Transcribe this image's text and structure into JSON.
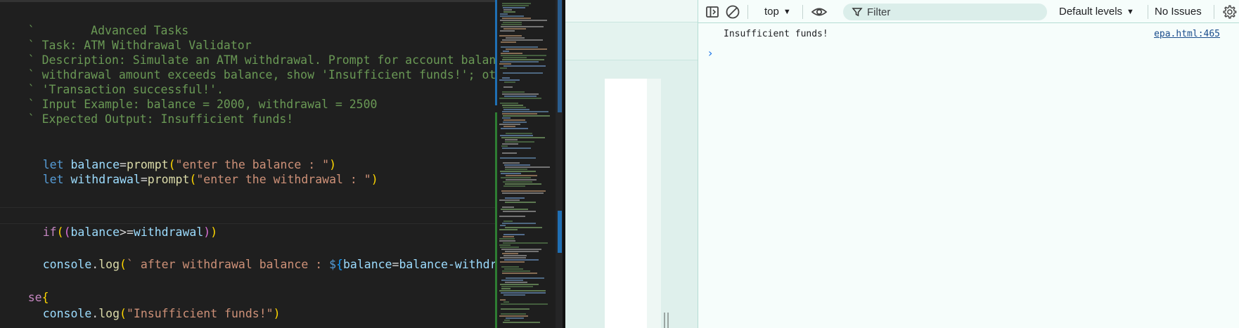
{
  "editor": {
    "lines": [
      {
        "indent": "        ",
        "text": "Advanced Tasks",
        "type": "comment"
      },
      {
        "indent": " ",
        "text": "Task: ATM Withdrawal Validator",
        "type": "comment"
      },
      {
        "indent": " ",
        "text": "Description: Simulate an ATM withdrawal. Prompt for account balance and",
        "type": "comment"
      },
      {
        "indent": " ",
        "text": "withdrawal amount exceeds balance, show 'Insufficient funds!'; otherwise",
        "type": "comment"
      },
      {
        "indent": " ",
        "text": "'Transaction successful!'.",
        "type": "comment"
      },
      {
        "indent": " ",
        "text": "Input Example: balance = 2000, withdrawal = 2500",
        "type": "comment"
      },
      {
        "indent": " ",
        "text": "Expected Output: Insufficient funds!",
        "type": "comment"
      }
    ],
    "code": {
      "line1": {
        "kw": "let",
        "var": "balance",
        "op": "=",
        "fn": "prompt",
        "str": "\"enter the balance : \""
      },
      "line2": {
        "kw": "let",
        "var": "withdrawal",
        "op": "=",
        "fn": "prompt",
        "str": "\"enter the withdrawal : \""
      },
      "line3": {
        "kw": "if",
        "a": "balance",
        "op": ">=",
        "b": "withdrawal"
      },
      "line4": {
        "obj": "console",
        "fn": "log",
        "str": " after withdrawal balance : ",
        "dollar": "$",
        "expr_a": "balance",
        "op": "=",
        "expr_b": "balance-withdrawal"
      },
      "line5": {
        "kw": "se"
      },
      "line6": {
        "obj": "console",
        "fn": "log",
        "str": "\"Insufficient funds!\""
      }
    }
  },
  "devtools": {
    "toolbar": {
      "context": "top",
      "filter_placeholder": "Filter",
      "levels": "Default levels",
      "issues": "No Issues"
    },
    "console": {
      "message": "Insufficient funds!",
      "source": "epa.html:465"
    }
  },
  "colors": {
    "editor_bg": "#1f1f1f",
    "devtools_bg": "#f6fdfb",
    "link": "#1a4d8c"
  }
}
